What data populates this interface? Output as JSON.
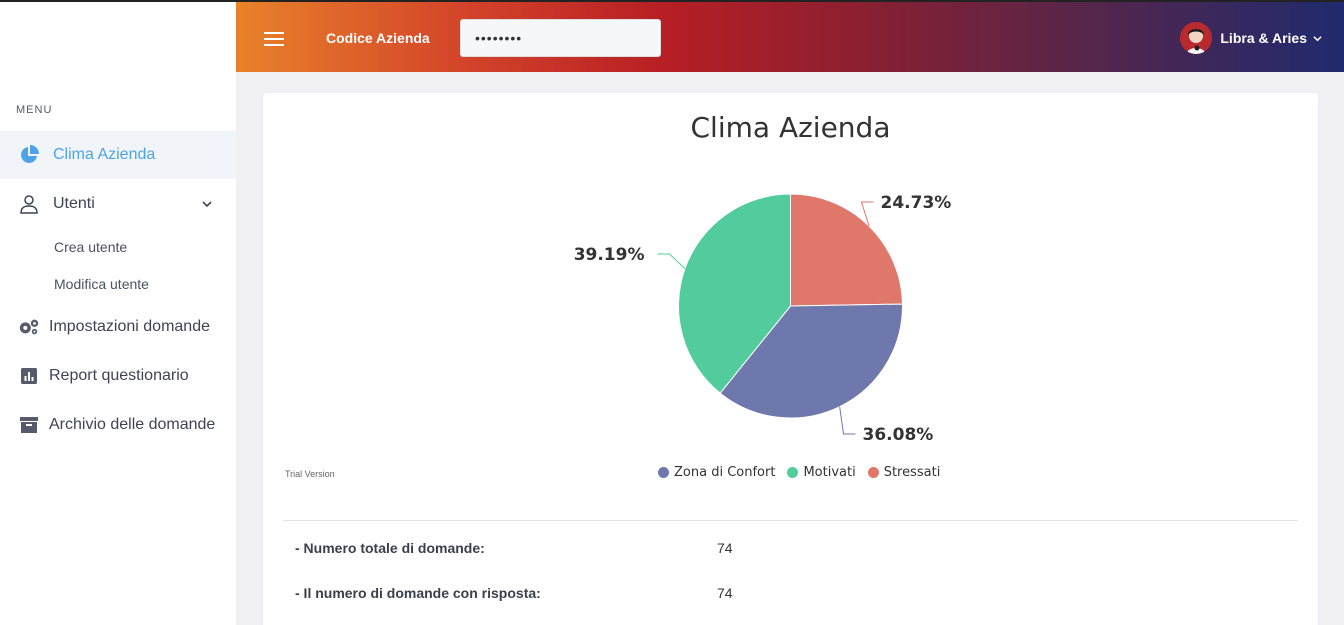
{
  "sidebar": {
    "menu_title": "MENU",
    "items": [
      {
        "label": "Clima Azienda",
        "icon": "pie-chart-icon",
        "active": true
      },
      {
        "label": "Utenti",
        "icon": "user-icon",
        "expanded": true
      },
      {
        "label": "Impostazioni domande",
        "icon": "gears-icon"
      },
      {
        "label": "Report questionario",
        "icon": "bar-chart-icon"
      },
      {
        "label": "Archivio delle domande",
        "icon": "archive-icon"
      }
    ],
    "sub_items": [
      {
        "label": "Crea utente"
      },
      {
        "label": "Modifica utente"
      }
    ]
  },
  "header": {
    "codice_label": "Codice Azienda",
    "codice_value": "••••••••",
    "user_name": "Libra & Aries"
  },
  "colors": {
    "accent": "#4da3e6",
    "zona": "#6e78ad",
    "motivati": "#52cc9c",
    "stressati": "#e0776b"
  },
  "chart_data": {
    "type": "pie",
    "title": "Clima Azienda",
    "categories": [
      "Zona di Confort",
      "Motivati",
      "Stressati"
    ],
    "values": [
      36.08,
      39.19,
      24.73
    ],
    "labels": [
      "36.08%",
      "39.19%",
      "24.73%"
    ],
    "legend": "bottom",
    "watermark": "Trial Version"
  },
  "stats": [
    {
      "label": "- Numero totale di domande:",
      "value": "74"
    },
    {
      "label": "- Il numero di domande con risposta:",
      "value": "74"
    }
  ]
}
